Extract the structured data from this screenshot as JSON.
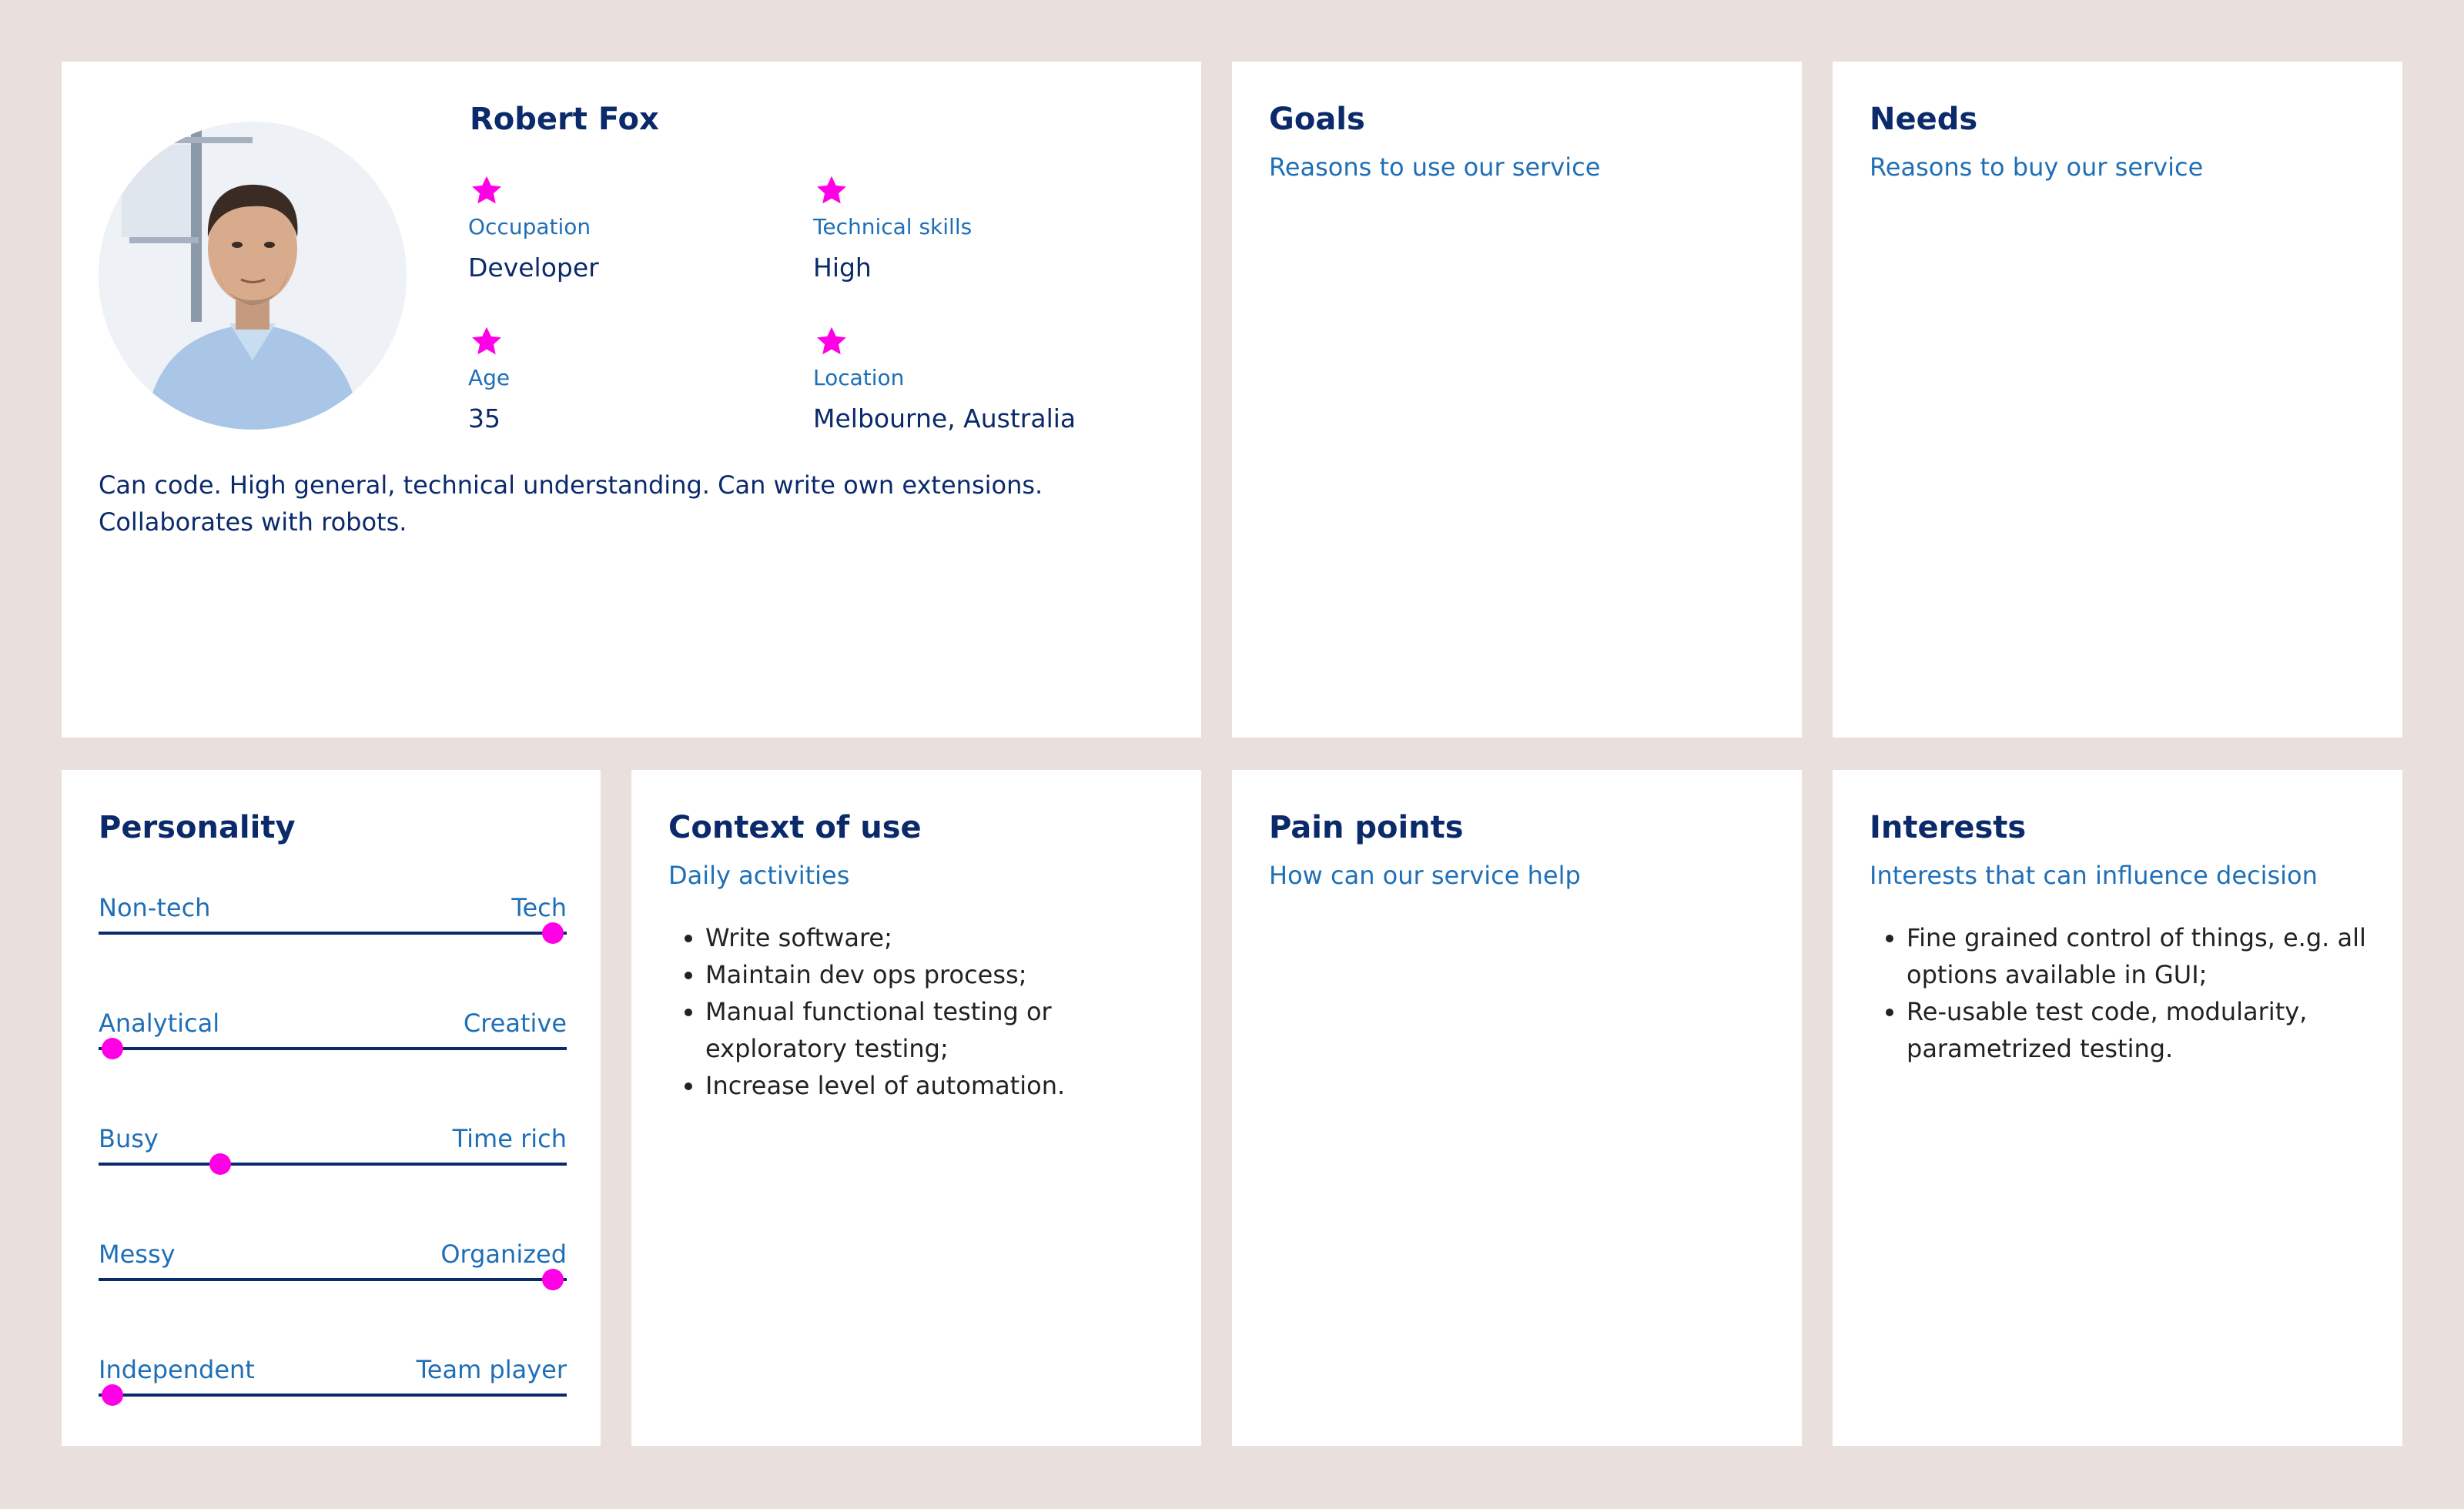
{
  "profile": {
    "name": "Robert Fox",
    "attributes": [
      {
        "label": "Occupation",
        "value": "Developer"
      },
      {
        "label": "Technical skills",
        "value": "High"
      },
      {
        "label": "Age",
        "value": "35"
      },
      {
        "label": "Location",
        "value": "Melbourne, Australia"
      }
    ],
    "description_line1": "Can code. High general, technical understanding. Can write own extensions.",
    "description_line2": "Collaborates with robots."
  },
  "goals": {
    "title": "Goals",
    "subtitle": "Reasons to use our service"
  },
  "needs": {
    "title": "Needs",
    "subtitle": "Reasons to buy our service"
  },
  "personality": {
    "title": "Personality",
    "sliders": [
      {
        "left": "Non-tech",
        "right": "Tech",
        "value": 0.97
      },
      {
        "left": "Analytical",
        "right": "Creative",
        "value": 0.03
      },
      {
        "left": "Busy",
        "right": "Time rich",
        "value": 0.26
      },
      {
        "left": "Messy",
        "right": "Organized",
        "value": 0.97
      },
      {
        "left": "Independent",
        "right": "Team player",
        "value": 0.03
      }
    ]
  },
  "context": {
    "title": "Context of use",
    "subtitle": "Daily activities",
    "items": [
      "Write software;",
      "Maintain dev ops process;",
      "Manual functional testing or exploratory testing;",
      "Increase level of automation."
    ]
  },
  "pain_points": {
    "title": "Pain points",
    "subtitle": "How can our service help"
  },
  "interests": {
    "title": "Interests",
    "subtitle": "Interests that can influence decision",
    "items": [
      "Fine grained control of things, e.g. all options available in GUI;",
      "Re-usable test code, modularity, parametrized testing."
    ]
  },
  "colors": {
    "background": "#e9dfdc",
    "heading": "#0b2a6b",
    "accent_text": "#1f6fb7",
    "highlight": "#ff00e6"
  },
  "icons": {
    "attribute_marker": "star-icon"
  }
}
